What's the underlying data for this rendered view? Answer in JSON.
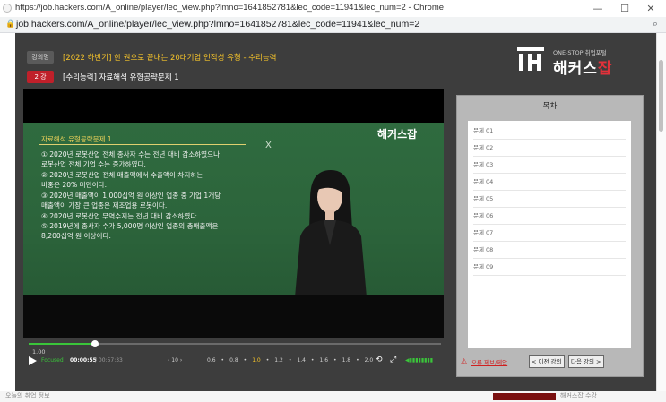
{
  "window": {
    "title": "https://job.hackers.com/A_online/player/lec_view.php?lmno=1641852781&lec_code=11941&lec_num=2 - Chrome",
    "minimize": "—",
    "maximize": "☐",
    "close": "✕"
  },
  "address": {
    "url": "job.hackers.com/A_online/player/lec_view.php?lmno=1641852781&lec_code=11941&lec_num=2",
    "lock_icon": "lock-icon",
    "zoom_icon": "zoom-icon"
  },
  "header": {
    "course_badge": "강의명",
    "course_title": "[2022 하반기] 한 권으로 끝내는 20대기업 인적성 유형 - 수리능력",
    "lecture_badge": "2 강",
    "lecture_title": "[수리능력] 자료해석 유형공략문제 1",
    "brand_sub": "ONE-STOP 취업포털",
    "brand_name_a": "해커스",
    "brand_name_b": "잡"
  },
  "board": {
    "title": "자료해석 유형공략문제 1",
    "logo": "해커스잡",
    "lines": [
      "① 2020년 로봇산업 전체 종사자 수는 전년 대비 감소하였으나",
      "    로봇산업 전체 기업 수는 증가하였다.",
      "② 2020년 로봇산업 전체 매출액에서 수출액이 차지하는",
      "    비중은 20% 미만이다.",
      "③ 2020년 매출액이 1,000십억 원 이상인 업종 중 기업 1개당",
      "    매출액이 가장 큰 업종은 제조업용 로봇이다.",
      "④ 2020년 로봇산업 무역수지는 전년 대비 감소하였다.",
      "⑤ 2019년에 종사자 수가 5,000명 이상인 업종의 총매출액은",
      "    8,200십억 원 이상이다."
    ]
  },
  "controls": {
    "speed_current": "1.00",
    "mode": "Focused",
    "time_current": "00:00:55",
    "time_total": "/ 00:57:33",
    "skip": "‹  10  ›",
    "speeds": [
      "0.6",
      "0.8",
      "1.0",
      "1.2",
      "1.4",
      "1.6",
      "1.8",
      "2.0"
    ],
    "active_speed": "1.0",
    "progress": 0.16
  },
  "toc": {
    "title": "목차",
    "items": [
      "문제 01",
      "문제 02",
      "문제 03",
      "문제 04",
      "문제 05",
      "문제 06",
      "문제 07",
      "문제 08",
      "문제 09"
    ],
    "error_link": "오류 제보/제안",
    "prev": "< 이전 강의",
    "next": "다음 강의 >"
  },
  "bottom": {
    "left_text": "오늘의 취업 정보",
    "right_text": "해커스잡 수강"
  },
  "colors": {
    "accent_yellow": "#f6c42a",
    "accent_red": "#c0202a",
    "progress_green": "#3ac53a"
  }
}
